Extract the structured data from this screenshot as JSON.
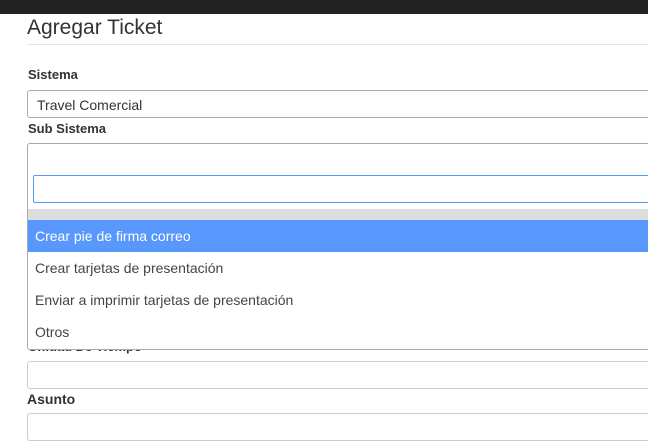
{
  "page": {
    "title": "Agregar Ticket"
  },
  "form": {
    "sistema": {
      "label": "Sistema",
      "value": "Travel Comercial"
    },
    "sub_sistema": {
      "label": "Sub Sistema",
      "value": "",
      "search_value": "",
      "options": [
        {
          "label": "Crear pie de firma correo",
          "highlighted": true
        },
        {
          "label": "Crear tarjetas de presentación",
          "highlighted": false
        },
        {
          "label": "Enviar a imprimir tarjetas de presentación",
          "highlighted": false
        },
        {
          "label": "Otros",
          "highlighted": false
        }
      ]
    },
    "unidad_de_tiempo": {
      "label": "Unidad De Tiempo",
      "value": ""
    },
    "asunto": {
      "label": "Asunto",
      "value": ""
    }
  },
  "colors": {
    "highlight": "#5897fb",
    "topbar": "#222222"
  }
}
